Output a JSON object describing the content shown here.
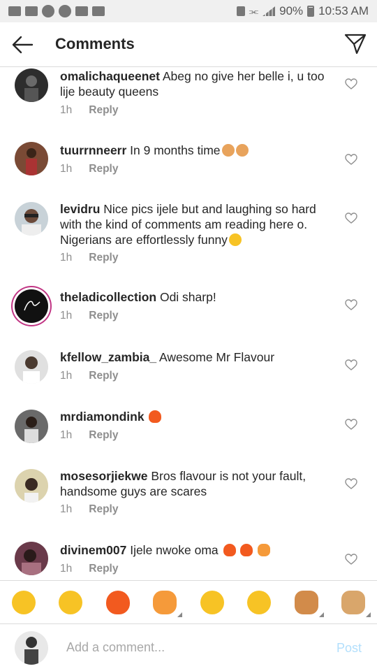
{
  "status_bar": {
    "battery": "90%",
    "time": "10:53 AM"
  },
  "header": {
    "title": "Comments",
    "back_icon": "arrow-left-icon",
    "share_icon": "paper-plane-icon"
  },
  "comments": [
    {
      "username": "omalichaqueenet",
      "text": "Abeg no give her belle i, u too lije beauty queens",
      "time": "1h",
      "reply": "Reply",
      "avatar_color": "#3a3a3a",
      "emojis": []
    },
    {
      "username": "tuurrnneerr",
      "text": "In 9 months time",
      "time": "1h",
      "reply": "Reply",
      "avatar_color": "#6b3b2a",
      "emojis": [
        "muscle",
        "muscle"
      ]
    },
    {
      "username": "levidru",
      "text": "Nice pics ijele but and laughing so hard with the kind of comments am reading here o. Nigerians are effortlessly funny",
      "time": "1h",
      "reply": "Reply",
      "avatar_color": "#b8c4cc",
      "emojis": [
        "laughing"
      ]
    },
    {
      "username": "theladicollection",
      "text": "Odi sharp!",
      "time": "1h",
      "reply": "Reply",
      "avatar_color": "#111111",
      "emojis": []
    },
    {
      "username": "kfellow_zambia_",
      "text": "Awesome Mr Flavour",
      "time": "1h",
      "reply": "Reply",
      "avatar_color": "#d9d9d9",
      "emojis": []
    },
    {
      "username": "mrdiamondink",
      "text": "",
      "time": "1h",
      "reply": "Reply",
      "avatar_color": "#5a5a5a",
      "emojis": [
        "fire"
      ]
    },
    {
      "username": "mosesorjiekwe",
      "text": "Bros flavour is not your fault, handsome guys are scares",
      "time": "1h",
      "reply": "Reply",
      "avatar_color": "#d8cfa8",
      "emojis": []
    },
    {
      "username": "divinem007",
      "text": "Ijele nwoke oma",
      "time": "1h",
      "reply": "Reply",
      "avatar_color": "#7a4a5a",
      "emojis": [
        "fire",
        "fire",
        "person-gesturing"
      ]
    }
  ],
  "emoji_bar": [
    {
      "name": "rolling-laughing-emoji",
      "color": "#f7c325"
    },
    {
      "name": "tears-of-joy-emoji",
      "color": "#f7c325"
    },
    {
      "name": "fire-emoji",
      "color": "#f25a1f"
    },
    {
      "name": "person-emoji",
      "color": "#f59a3a"
    },
    {
      "name": "grinning-emoji",
      "color": "#f7c325"
    },
    {
      "name": "pleading-emoji",
      "color": "#f7c325"
    },
    {
      "name": "fist-emoji",
      "color": "#d28b4a"
    },
    {
      "name": "ok-hand-emoji",
      "color": "#d9a66b"
    }
  ],
  "composer": {
    "placeholder": "Add a comment...",
    "post_label": "Post",
    "avatar_color": "#444444"
  },
  "colors": {
    "fire": "#f25a1f",
    "muscle": "#e8a35c",
    "laughing": "#f7c325",
    "person-gesturing": "#f59a3a",
    "heart_stroke": "#8e8e8e",
    "post": "#b2dffc"
  }
}
